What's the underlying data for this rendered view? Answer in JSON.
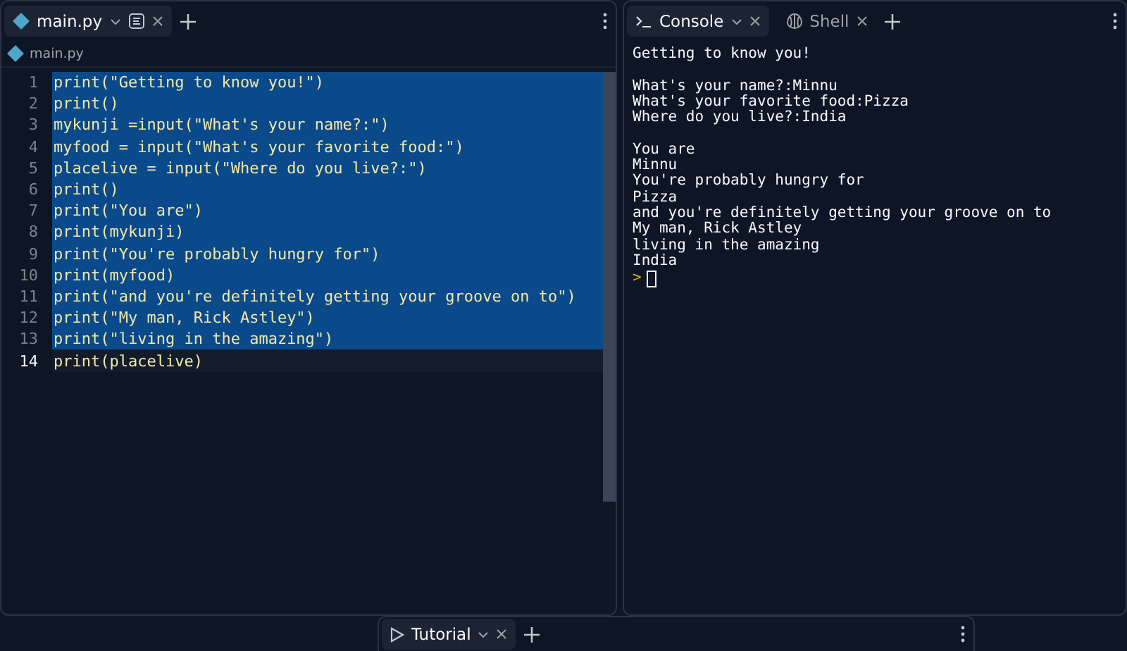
{
  "editor": {
    "tabs": [
      {
        "label": "main.py",
        "selected": true
      }
    ],
    "breadcrumb": "main.py",
    "lines": [
      {
        "number": "1",
        "code": "print(\"Getting to know you!\")",
        "selected": true,
        "current": false
      },
      {
        "number": "2",
        "code": "print()",
        "selected": true,
        "current": false
      },
      {
        "number": "3",
        "code": "mykunji =input(\"What's your name?:\")",
        "selected": true,
        "current": false
      },
      {
        "number": "4",
        "code": "myfood = input(\"What's your favorite food:\")",
        "selected": true,
        "current": false
      },
      {
        "number": "5",
        "code": "placelive = input(\"Where do you live?:\")",
        "selected": true,
        "current": false
      },
      {
        "number": "6",
        "code": "print()",
        "selected": true,
        "current": false
      },
      {
        "number": "7",
        "code": "print(\"You are\")",
        "selected": true,
        "current": false
      },
      {
        "number": "8",
        "code": "print(mykunji)",
        "selected": true,
        "current": false
      },
      {
        "number": "9",
        "code": "print(\"You're probably hungry for\")",
        "selected": true,
        "current": false
      },
      {
        "number": "10",
        "code": "print(myfood)",
        "selected": true,
        "current": false
      },
      {
        "number": "11",
        "code": "print(\"and you're definitely getting your groove on to\")",
        "selected": true,
        "current": false
      },
      {
        "number": "12",
        "code": "print(\"My man, Rick Astley\")",
        "selected": true,
        "current": false
      },
      {
        "number": "13",
        "code": "print(\"living in the amazing\")",
        "selected": true,
        "current": false
      },
      {
        "number": "14",
        "code": "print(placelive)",
        "selected": false,
        "current": true
      }
    ]
  },
  "console": {
    "tabs": [
      {
        "label": "Console",
        "selected": true,
        "kind": "console"
      },
      {
        "label": "Shell",
        "selected": false,
        "kind": "shell"
      }
    ],
    "output": [
      [
        "Getting to know you!"
      ],
      [
        "What's your name?:Minnu",
        "What's your favorite food:Pizza",
        "Where do you live?:India"
      ],
      [
        "You are",
        "Minnu",
        "You're probably hungry for",
        "Pizza",
        "and you're definitely getting your groove on to",
        "My man, Rick Astley",
        "living in the amazing",
        "India"
      ]
    ],
    "prompt": ">"
  },
  "bottom": {
    "tabs": [
      {
        "label": "Tutorial",
        "selected": true
      }
    ]
  }
}
